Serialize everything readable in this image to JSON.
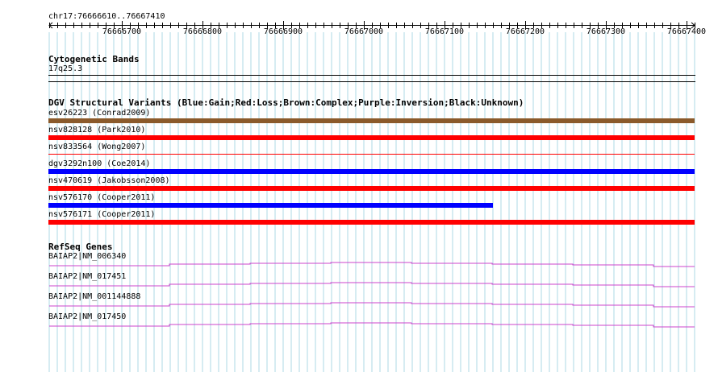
{
  "ruler": {
    "location": "chr17:76666610..76667410",
    "ticks": [
      76666700,
      76666800,
      76666900,
      76667000,
      76667100,
      76667200,
      76667300,
      76667400
    ],
    "range": [
      76666610,
      76667410
    ]
  },
  "cytobands": {
    "title": "Cytogenetic Bands",
    "band": "17q25.3"
  },
  "dgv": {
    "title": "DGV Structural Variants (Blue:Gain;Red:Loss;Brown:Complex;Purple:Inversion;Black:Unknown)",
    "colors": {
      "gain": "#0000ff",
      "loss": "#ff0000",
      "complex": "#8b5a2b",
      "inversion": "#800080",
      "unknown": "#000000"
    },
    "variants": [
      {
        "label": "esv26223 (Conrad2009)",
        "type": "complex",
        "style": "thick",
        "start": 76666610,
        "end": 76667410
      },
      {
        "label": "nsv828128 (Park2010)",
        "type": "loss",
        "style": "thick",
        "start": 76666610,
        "end": 76667410
      },
      {
        "label": "nsv833564 (Wong2007)",
        "type": "loss",
        "style": "thin",
        "start": 76666610,
        "end": 76667410
      },
      {
        "label": "dgv3292n100 (Coe2014)",
        "type": "gain",
        "style": "thick",
        "start": 76666610,
        "end": 76667410
      },
      {
        "label": "nsv470619 (Jakobsson2008)",
        "type": "loss",
        "style": "thick",
        "start": 76666610,
        "end": 76667410
      },
      {
        "label": "nsv576170 (Cooper2011)",
        "type": "gain",
        "style": "thick",
        "start": 76666610,
        "end": 76667160
      },
      {
        "label": "nsv576171 (Cooper2011)",
        "type": "loss",
        "style": "thick",
        "start": 76666610,
        "end": 76667410
      }
    ]
  },
  "refseq": {
    "title": "RefSeq Genes",
    "color": "#cc44cc",
    "genes": [
      {
        "label": "BAIAP2|NM_006340"
      },
      {
        "label": "BAIAP2|NM_017451"
      },
      {
        "label": "BAIAP2|NM_001144888"
      },
      {
        "label": "BAIAP2|NM_017450"
      }
    ]
  }
}
